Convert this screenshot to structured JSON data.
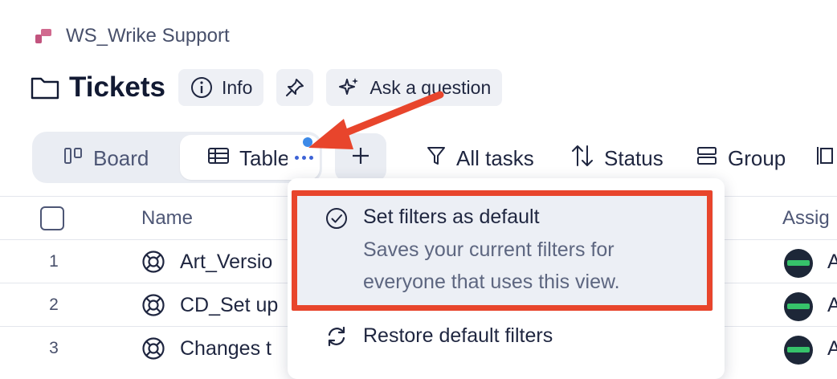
{
  "breadcrumb": {
    "space": "WS_Wrike Support",
    "icon": "space-logo-icon"
  },
  "header": {
    "title": "Tickets",
    "info_label": "Info",
    "ask_label": "Ask a question"
  },
  "views": {
    "board_label": "Board",
    "table_label": "Table"
  },
  "toolbar": {
    "filter_label": "All tasks",
    "sort_label": "Status",
    "group_label": "Group"
  },
  "table": {
    "columns": {
      "name": "Name",
      "assignee": "Assig"
    },
    "rows": [
      {
        "num": "1",
        "title": "Art_Versio",
        "assignee": "A"
      },
      {
        "num": "2",
        "title": "CD_Set up",
        "assignee": "A"
      },
      {
        "num": "3",
        "title": "Changes t",
        "assignee": "A"
      }
    ]
  },
  "menu": {
    "items": [
      {
        "title": "Set filters as default",
        "desc_line1": "Saves your current filters for",
        "desc_line2": "everyone that uses this view."
      },
      {
        "title": "Restore default filters"
      }
    ]
  },
  "colors": {
    "highlight": "#e8452c",
    "accent": "#3d63d6",
    "badge": "#36c26a"
  }
}
